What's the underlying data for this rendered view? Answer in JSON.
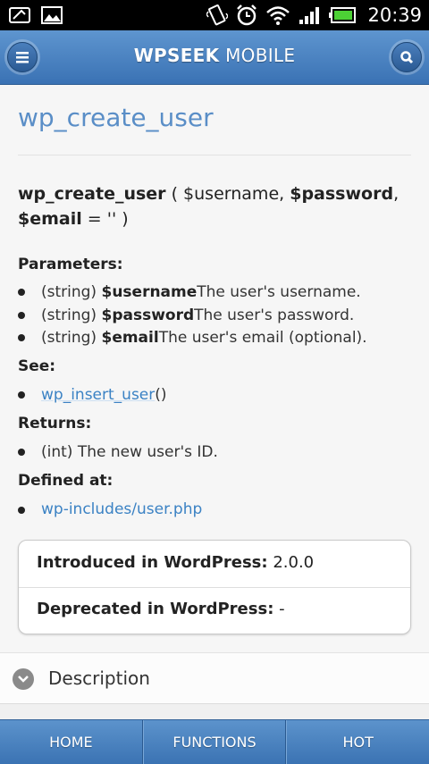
{
  "status_bar": {
    "time": "20:39",
    "icons": [
      "screenshot-icon",
      "gallery-icon",
      "vibrate-icon",
      "alarm-icon",
      "wifi-icon",
      "signal-icon",
      "battery-icon"
    ]
  },
  "header": {
    "title_bold": "WPSEEK",
    "title_light": " MOBILE",
    "menu_icon": "menu-icon",
    "search_icon": "search-icon"
  },
  "page": {
    "title": "wp_create_user",
    "signature": {
      "func": "wp_create_user",
      "open": " ( $username, ",
      "p2": "$password",
      "comma": ",",
      "p3": "$email",
      "rest": " = '' )"
    },
    "parameters_heading": "Parameters:",
    "parameters": [
      {
        "type": "(string) ",
        "name": "$username",
        "desc": " The user's username."
      },
      {
        "type": "(string) ",
        "name": "$password",
        "desc": " The user's password."
      },
      {
        "type": "(string) ",
        "name": "$email",
        "desc": " The user's email (optional)."
      }
    ],
    "see_heading": "See:",
    "see_link": "wp_insert_user",
    "see_suffix": "()",
    "returns_heading": "Returns:",
    "returns_text": "(int) The new user's ID.",
    "defined_heading": "Defined at:",
    "defined_link": "wp-includes/user.php",
    "introduced_label": "Introduced in WordPress:",
    "introduced_value": " 2.0.0",
    "deprecated_label": "Deprecated in WordPress:",
    "deprecated_value": " -",
    "description_label": "Description"
  },
  "nav": {
    "home": "HOME",
    "functions": "FUNCTIONS",
    "hot": "HOT"
  },
  "colors": {
    "header_blue": "#4a82c1",
    "link_blue": "#3b82c4",
    "title_blue": "#5a8ec7"
  }
}
